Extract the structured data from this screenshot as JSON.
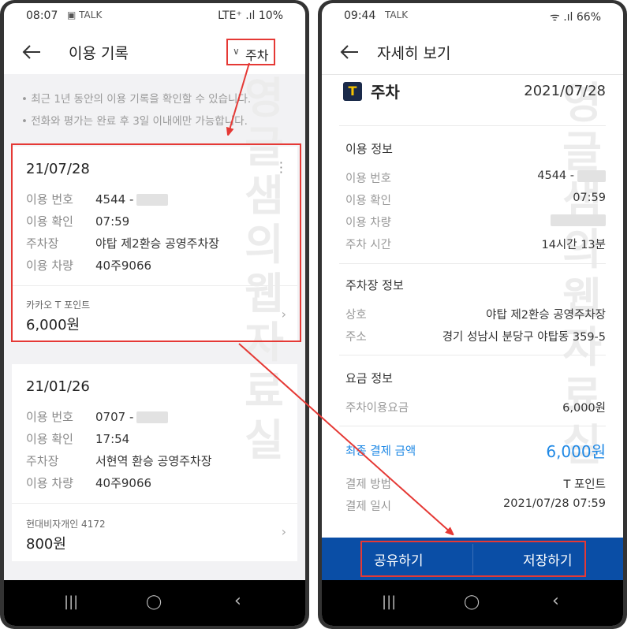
{
  "left": {
    "status": {
      "time": "08:07",
      "icons": "▣ TALK",
      "right": "LTE⁺ .ıl 10%"
    },
    "header": {
      "title": "이용 기록",
      "filter_label": "주차"
    },
    "notes": [
      "• 최근 1년 동안의 이용 기록을 확인할 수 있습니다.",
      "• 전화와 평가는 완료 후 3일 이내에만 가능합니다."
    ],
    "records": [
      {
        "date": "21/07/28",
        "rows": [
          {
            "k": "이용 번호",
            "v": "4544 -"
          },
          {
            "k": "이용 확인",
            "v": "07:59"
          },
          {
            "k": "주차장",
            "v": "야탑 제2환승 공영주차장"
          },
          {
            "k": "이용 차량",
            "v": "40주9066"
          }
        ],
        "pay_method": "카카오 T 포인트",
        "amount": "6,000원"
      },
      {
        "date": "21/01/26",
        "rows": [
          {
            "k": "이용 번호",
            "v": "0707 -"
          },
          {
            "k": "이용 확인",
            "v": "17:54"
          },
          {
            "k": "주차장",
            "v": "서현역 환승 공영주차장"
          },
          {
            "k": "이용 차량",
            "v": "40주9066"
          }
        ],
        "pay_method": "현대비자개인 4172",
        "amount": "800원"
      }
    ]
  },
  "right": {
    "status": {
      "time": "09:44",
      "icons": "TALK",
      "right": "ᯤ .ıl 66%"
    },
    "header": {
      "title": "자세히 보기"
    },
    "service": {
      "logo": "T",
      "name": "주차",
      "date": "2021/07/28"
    },
    "usage": {
      "title": "이용 정보",
      "rows": [
        {
          "k": "이용 번호",
          "v": "4544 -"
        },
        {
          "k": "이용 확인",
          "v": "07:59"
        },
        {
          "k": "이용 차량",
          "v": ""
        },
        {
          "k": "주차 시간",
          "v": "14시간 13분"
        }
      ]
    },
    "lot": {
      "title": "주차장 정보",
      "rows": [
        {
          "k": "상호",
          "v": "야탑 제2환승 공영주차장"
        },
        {
          "k": "주소",
          "v": "경기 성남시 분당구 야탑동 359-5"
        }
      ]
    },
    "fee": {
      "title": "요금 정보",
      "rows": [
        {
          "k": "주차이용요금",
          "v": "6,000원"
        }
      ]
    },
    "final": {
      "k": "최종 결제 금액",
      "v": "6,000원"
    },
    "payment": [
      {
        "k": "결제 방법",
        "v": "T 포인트"
      },
      {
        "k": "결제 일시",
        "v": "2021/07/28 07:59"
      }
    ],
    "buttons": {
      "share": "공유하기",
      "save": "저장하기"
    }
  },
  "navbar": {
    "recent": "|||",
    "home": "◯",
    "back": "‹"
  },
  "watermark_left": [
    "영",
    "글",
    "샘",
    "의",
    "웹",
    "자",
    "료",
    "실"
  ],
  "watermark_right": [
    "영",
    "글",
    "샘",
    "의",
    "웹",
    "자",
    "료",
    "실"
  ],
  "colors": {
    "highlight": "#e53935",
    "accent_blue": "#1e88e5",
    "bottom_bar": "#0a4ea6"
  }
}
